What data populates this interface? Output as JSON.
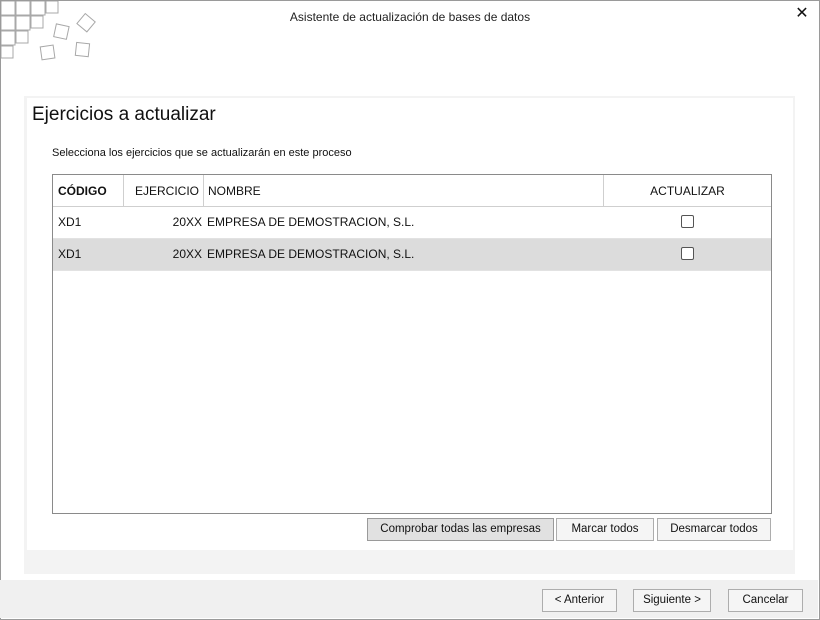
{
  "window": {
    "title": "Asistente de actualización de bases de datos",
    "close_label": "✕"
  },
  "page": {
    "heading": "Ejercicios a actualizar",
    "subtitle": "Selecciona los ejercicios que se actualizarán en este proceso"
  },
  "table": {
    "headers": {
      "codigo": "CÓDIGO",
      "ejercicio": "EJERCICIO",
      "nombre": "NOMBRE",
      "actualizar": "ACTUALIZAR"
    },
    "rows": [
      {
        "codigo": "XD1",
        "ejercicio": "20XX",
        "nombre": "EMPRESA DE DEMOSTRACION, S.L.",
        "actualizar": false
      },
      {
        "codigo": "XD1",
        "ejercicio": "20XX",
        "nombre": "EMPRESA DE DEMOSTRACION, S.L.",
        "actualizar": false
      }
    ]
  },
  "actions": {
    "comprobar": "Comprobar todas las empresas",
    "marcar": "Marcar todos",
    "desmarcar": "Desmarcar todos"
  },
  "footer": {
    "anterior": "< Anterior",
    "siguiente": "Siguiente >",
    "cancelar": "Cancelar"
  },
  "colors": {
    "selected_row": "#dcdcdc",
    "panel_bg": "#f3f3f3",
    "footer_bg": "#f0f0f0"
  },
  "icons": {
    "logo": "grid-squares-logo-icon",
    "close": "close-icon",
    "checkbox": "checkbox-unchecked-icon"
  }
}
